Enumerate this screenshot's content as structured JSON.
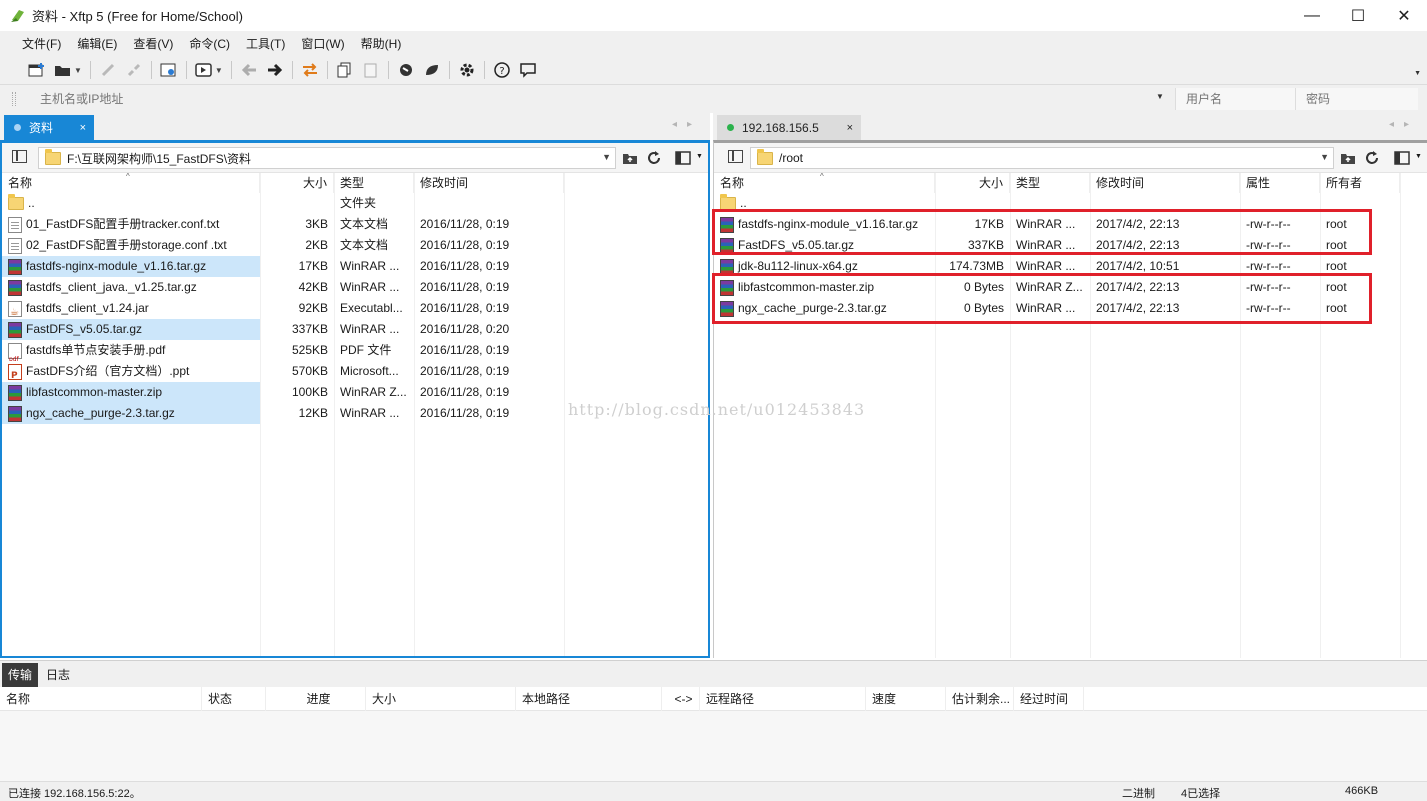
{
  "window": {
    "title": "资料 - Xftp 5 (Free for Home/School)",
    "controls": [
      "—",
      "☐",
      "✕"
    ]
  },
  "menu": [
    "文件(F)",
    "编辑(E)",
    "查看(V)",
    "命令(C)",
    "工具(T)",
    "窗口(W)",
    "帮助(H)"
  ],
  "address": {
    "host_placeholder": "主机名或IP地址",
    "user_placeholder": "用户名",
    "password_placeholder": "密码"
  },
  "left": {
    "tab_label": "资料",
    "tab_close": "×",
    "path": "F:\\互联网架构师\\15_FastDFS\\资料",
    "columns": [
      "名称",
      "大小",
      "类型",
      "修改时间"
    ],
    "files": [
      {
        "name": "..",
        "size": "",
        "type": "文件夹",
        "date": "",
        "icon": "folder",
        "selected": false
      },
      {
        "name": "01_FastDFS配置手册tracker.conf.txt",
        "size": "3KB",
        "type": "文本文档",
        "date": "2016/11/28, 0:19",
        "icon": "txt",
        "selected": false
      },
      {
        "name": "02_FastDFS配置手册storage.conf .txt",
        "size": "2KB",
        "type": "文本文档",
        "date": "2016/11/28, 0:19",
        "icon": "txt",
        "selected": false
      },
      {
        "name": "fastdfs-nginx-module_v1.16.tar.gz",
        "size": "17KB",
        "type": "WinRAR ...",
        "date": "2016/11/28, 0:19",
        "icon": "rar",
        "selected": true
      },
      {
        "name": "fastdfs_client_java._v1.25.tar.gz",
        "size": "42KB",
        "type": "WinRAR ...",
        "date": "2016/11/28, 0:19",
        "icon": "rar",
        "selected": false
      },
      {
        "name": "fastdfs_client_v1.24.jar",
        "size": "92KB",
        "type": "Executabl...",
        "date": "2016/11/28, 0:19",
        "icon": "jar",
        "selected": false
      },
      {
        "name": "FastDFS_v5.05.tar.gz",
        "size": "337KB",
        "type": "WinRAR ...",
        "date": "2016/11/28, 0:20",
        "icon": "rar",
        "selected": true
      },
      {
        "name": "fastdfs单节点安装手册.pdf",
        "size": "525KB",
        "type": "PDF 文件",
        "date": "2016/11/28, 0:19",
        "icon": "pdf",
        "selected": false
      },
      {
        "name": "FastDFS介绍（官方文档）.ppt",
        "size": "570KB",
        "type": "Microsoft...",
        "date": "2016/11/28, 0:19",
        "icon": "ppt",
        "selected": false
      },
      {
        "name": "libfastcommon-master.zip",
        "size": "100KB",
        "type": "WinRAR Z...",
        "date": "2016/11/28, 0:19",
        "icon": "rar",
        "selected": true
      },
      {
        "name": "ngx_cache_purge-2.3.tar.gz",
        "size": "12KB",
        "type": "WinRAR ...",
        "date": "2016/11/28, 0:19",
        "icon": "rar",
        "selected": true
      }
    ]
  },
  "right": {
    "tab_label": "192.168.156.5",
    "tab_close": "×",
    "path": "/root",
    "columns": [
      "名称",
      "大小",
      "类型",
      "修改时间",
      "属性",
      "所有者"
    ],
    "files": [
      {
        "name": "..",
        "size": "",
        "type": "",
        "date": "",
        "attr": "",
        "owner": "",
        "icon": "folder"
      },
      {
        "name": "fastdfs-nginx-module_v1.16.tar.gz",
        "size": "17KB",
        "type": "WinRAR ...",
        "date": "2017/4/2, 22:13",
        "attr": "-rw-r--r--",
        "owner": "root",
        "icon": "rar"
      },
      {
        "name": "FastDFS_v5.05.tar.gz",
        "size": "337KB",
        "type": "WinRAR ...",
        "date": "2017/4/2, 22:13",
        "attr": "-rw-r--r--",
        "owner": "root",
        "icon": "rar"
      },
      {
        "name": "jdk-8u112-linux-x64.gz",
        "size": "174.73MB",
        "type": "WinRAR ...",
        "date": "2017/4/2, 10:51",
        "attr": "-rw-r--r--",
        "owner": "root",
        "icon": "rar"
      },
      {
        "name": "libfastcommon-master.zip",
        "size": "0 Bytes",
        "type": "WinRAR Z...",
        "date": "2017/4/2, 22:13",
        "attr": "-rw-r--r--",
        "owner": "root",
        "icon": "rar"
      },
      {
        "name": "ngx_cache_purge-2.3.tar.gz",
        "size": "0 Bytes",
        "type": "WinRAR ...",
        "date": "2017/4/2, 22:13",
        "attr": "-rw-r--r--",
        "owner": "root",
        "icon": "rar"
      }
    ]
  },
  "watermark": "http://blog.csdn.net/u012453843",
  "bottom": {
    "tabs": [
      "传输",
      "日志"
    ],
    "columns": [
      "名称",
      "状态",
      "进度",
      "大小",
      "本地路径",
      "<->",
      "远程路径",
      "速度",
      "估计剩余...",
      "经过时间"
    ]
  },
  "status": {
    "connection": "已连接 192.168.156.5:22。",
    "mode": "二进制",
    "selection": "4已选择",
    "size": "466KB"
  },
  "colors": {
    "accent": "#1887d6",
    "selection": "#cce6fa",
    "highlight_box": "#e0202a",
    "connected_dot": "#2bb24c"
  }
}
